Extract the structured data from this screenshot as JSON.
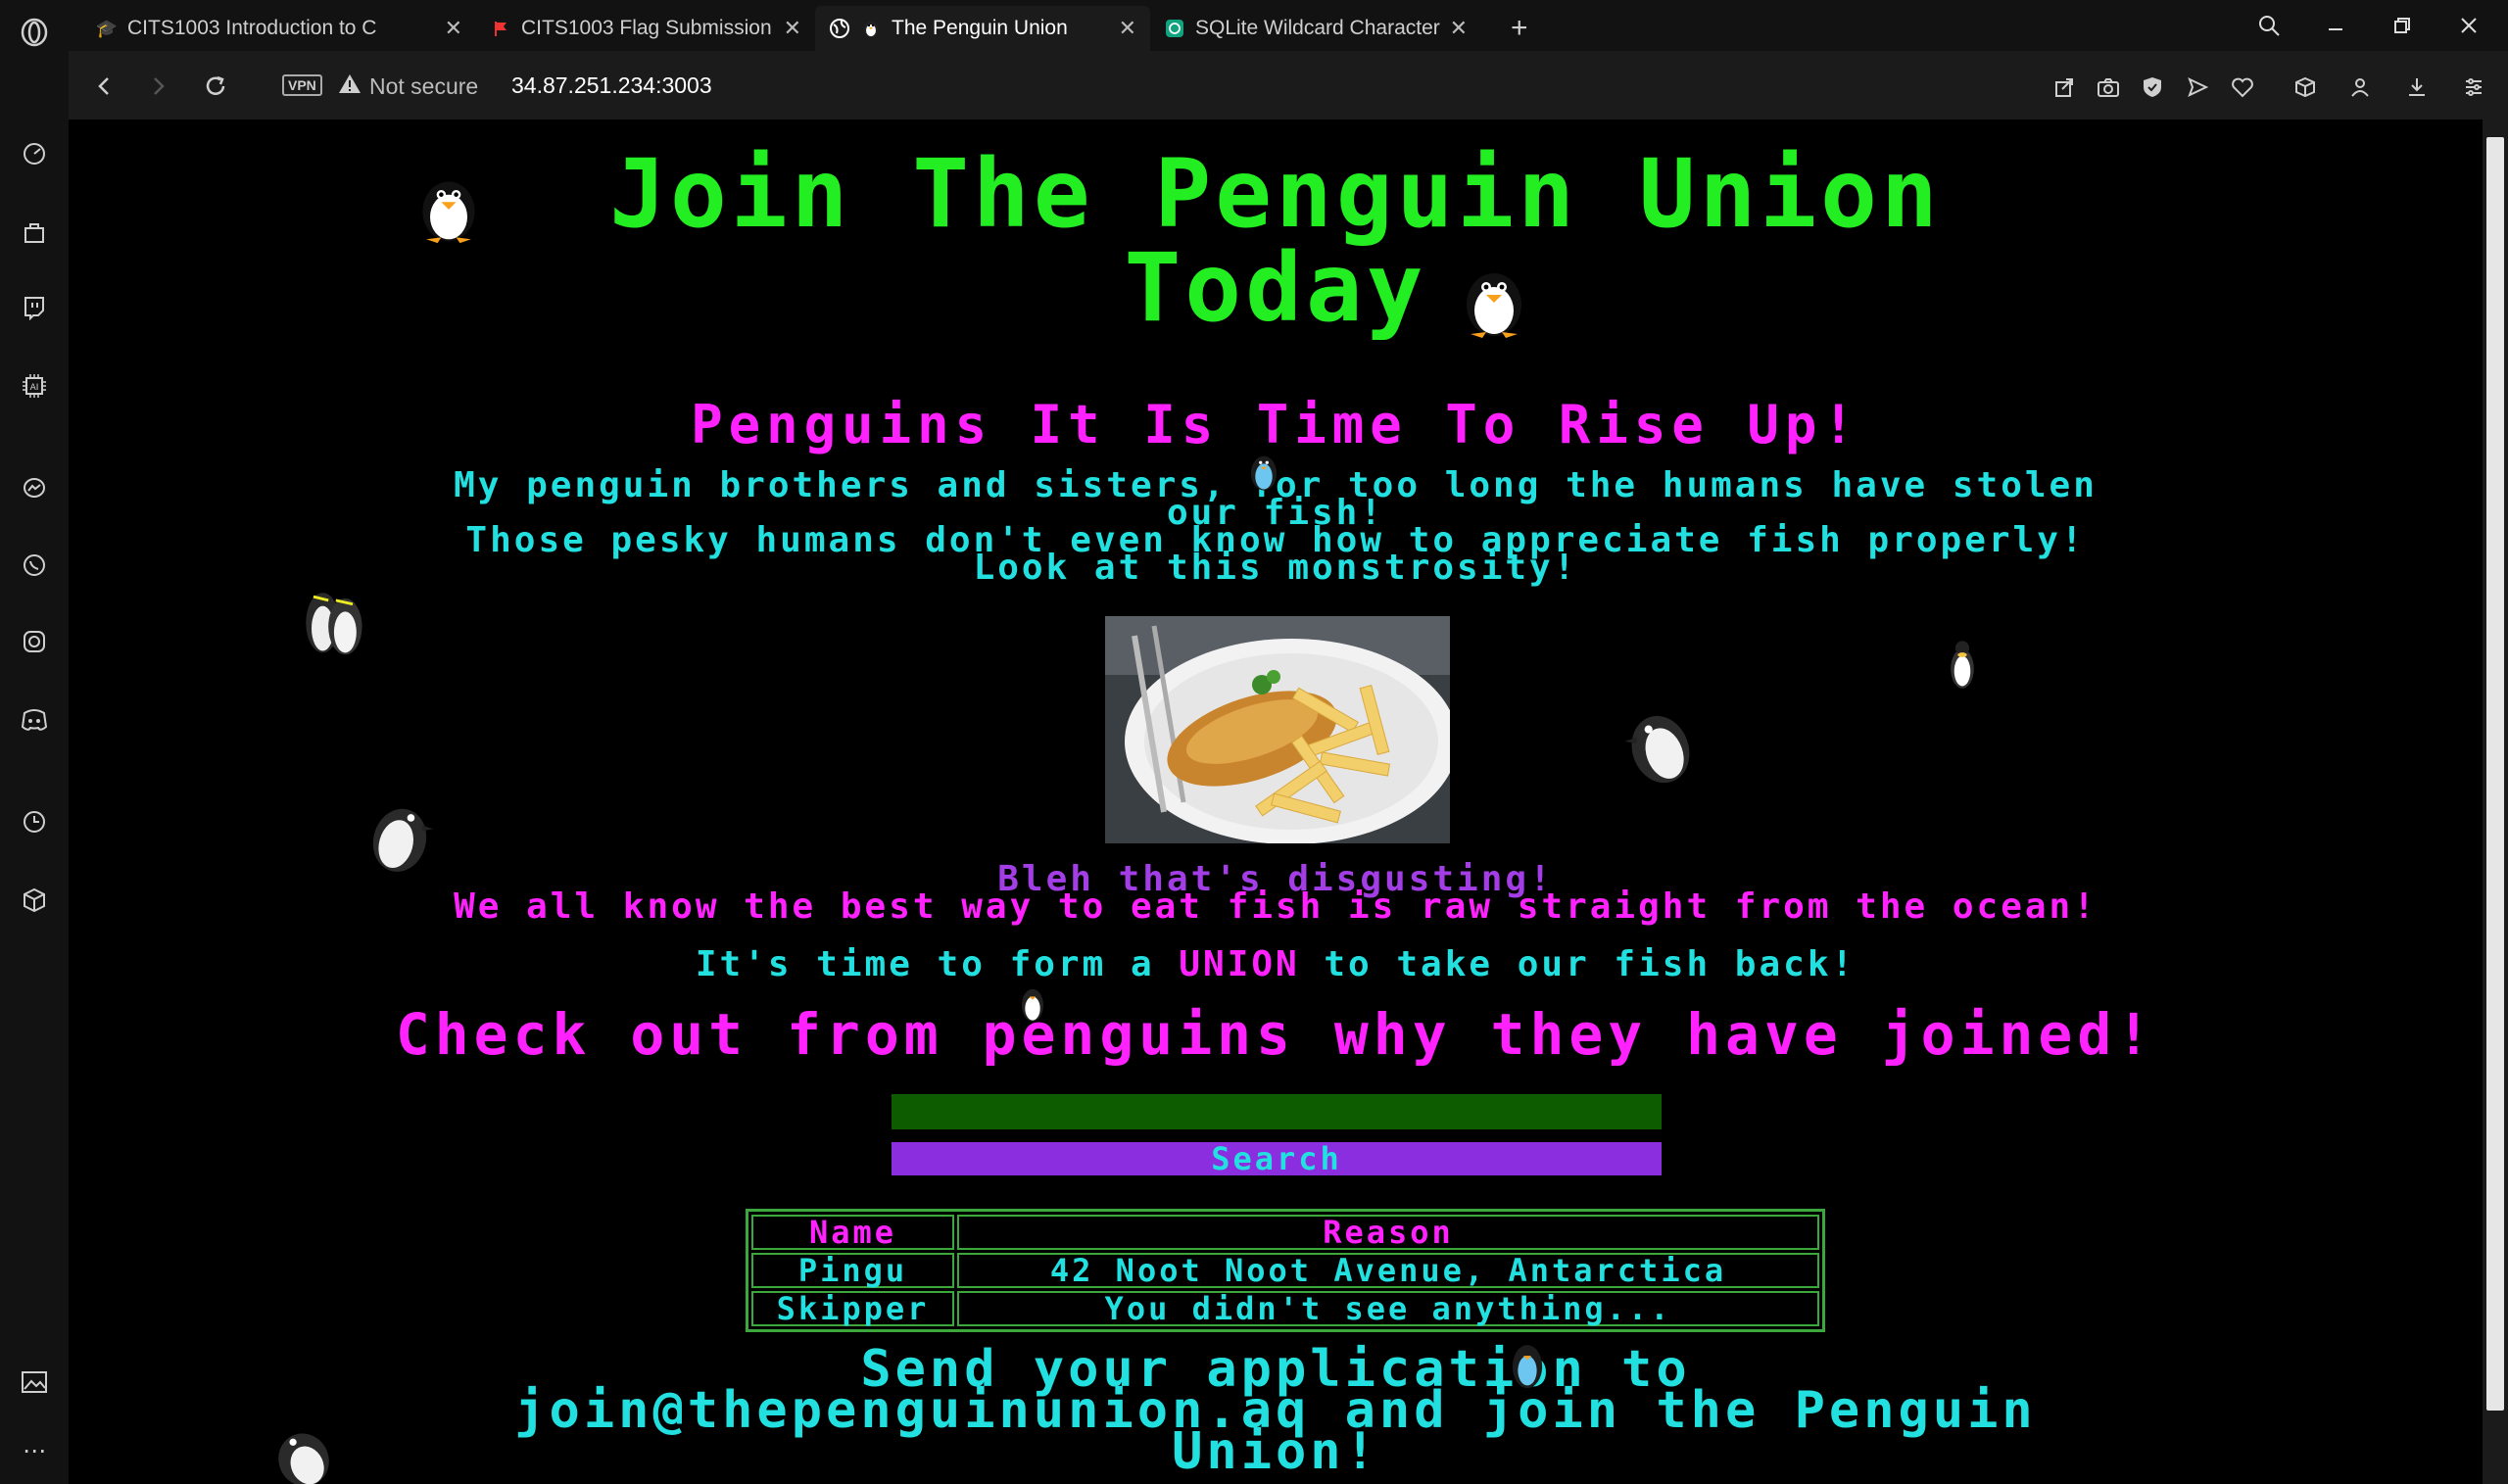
{
  "browser": {
    "tabs": [
      {
        "title": "CITS1003 Introduction to C",
        "icon": "graduation-cap-icon",
        "active": false
      },
      {
        "title": "CITS1003 Flag Submission",
        "icon": "flag-icon",
        "active": false
      },
      {
        "title": "The Penguin Union",
        "icon": "globe-icon",
        "active": true
      },
      {
        "title": "SQLite Wildcard Characters",
        "icon": "chatgpt-icon",
        "active": false
      }
    ],
    "new_tab": "+",
    "vpn_label": "VPN",
    "security_label": "Not secure",
    "url": "34.87.251.234:3003"
  },
  "page": {
    "title_line1": "Join The Penguin Union",
    "title_line2": "Today",
    "subtitle": "Penguins It Is Time To Rise Up!",
    "intro_lines": [
      "My penguin brothers and sisters, for too long the humans have stolen",
      "our fish!",
      "Those pesky humans don't even know how to appreciate fish properly!",
      "Look at this monstrosity!"
    ],
    "bleh_line1": "Bleh that's disgusting!",
    "bleh_line2": "We all know the best way to eat fish is raw straight from the ocean!",
    "union_pre": "It's time to form a ",
    "union_word": "UNION",
    "union_post": " to take our fish back!",
    "checkout": "Check out from penguins why they have joined!",
    "search": {
      "value": "",
      "button_label": "Search"
    },
    "table": {
      "headers": [
        "Name",
        "Reason"
      ],
      "rows": [
        [
          "Pingu",
          "42 Noot Noot Avenue, Antarctica"
        ],
        [
          "Skipper",
          "You didn't see anything..."
        ]
      ]
    },
    "footer_lines": [
      "Send your application to",
      "join@thepenguinunion.aq and join the Penguin",
      "Union!"
    ]
  },
  "colors": {
    "title": "#22ee22",
    "magenta": "#ff22ff",
    "cyan": "#22e0e0",
    "purple": "#a33ee6",
    "search_bg": "#0d5d00",
    "button_bg": "#8a2ee0",
    "table_border": "#3ca83c"
  }
}
